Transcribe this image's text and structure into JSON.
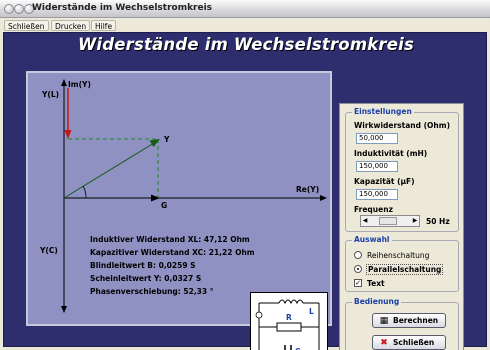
{
  "window": {
    "title": "Widerstände im Wechselstromkreis"
  },
  "menu": {
    "items": [
      "Schließen",
      "Drucken",
      "Hilfe"
    ]
  },
  "page": {
    "heading": "Widerstände im Wechselstromkreis"
  },
  "diagram": {
    "axis_im": "Im(Y)",
    "axis_yl": "Y(L)",
    "axis_re": "Re(Y)",
    "axis_yc": "Y(C)",
    "label_y": "Y",
    "label_g": "G",
    "results": [
      "Induktiver Widerstand XL: 47,12 Ohm",
      "Kapazitiver Widerstand XC: 21,22 Ohm",
      "Blindleitwert B: 0,0259 S",
      "Scheinleitwert Y: 0,0327 S",
      "Phasenverschiebung: 52,33 °"
    ],
    "colors": {
      "background": "#8e91c2",
      "green": "#1a8a1a",
      "red": "#c81414"
    }
  },
  "circuit": {
    "label_l": "L",
    "label_r": "R",
    "label_c": "C"
  },
  "settings": {
    "title": "Einstellungen",
    "wirk_label": "Wirkwiderstand (Ohm)",
    "wirk_value": "50,000",
    "ind_label": "Induktivität (mH)",
    "ind_value": "150,000",
    "kap_label": "Kapazität (µF)",
    "kap_value": "150,000",
    "freq_label": "Frequenz",
    "freq_value": "50 Hz"
  },
  "auswahl": {
    "title": "Auswahl",
    "reihen": "Reihenschaltung",
    "parallel": "Parallelschaltung",
    "text": "Text"
  },
  "bedienung": {
    "title": "Bedienung",
    "berechnen": "Berechnen",
    "schliessen": "Schließen"
  }
}
